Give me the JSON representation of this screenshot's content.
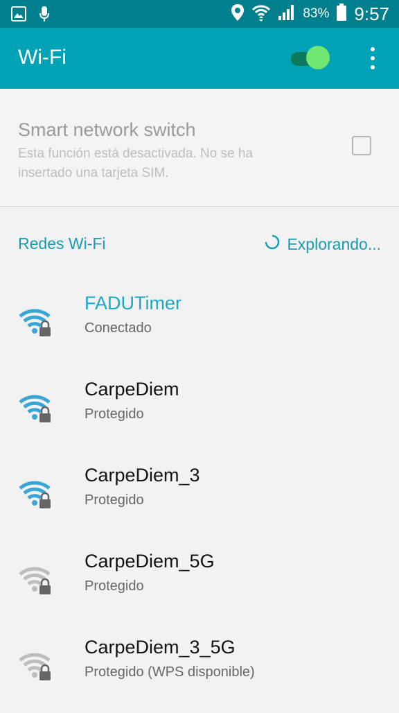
{
  "status_bar": {
    "left_icons": [
      "image-icon",
      "mic-icon"
    ],
    "right_icons": [
      "location-icon",
      "wifi-status-icon",
      "signal-icon",
      "battery-icon"
    ],
    "battery": "83%",
    "time": "9:57"
  },
  "header": {
    "title": "Wi-Fi",
    "wifi_enabled": true
  },
  "smart_switch": {
    "title": "Smart network switch",
    "description": "Esta función está desactivada. No se ha insertado una tarjeta SIM.",
    "checked": false
  },
  "networks_section": {
    "title": "Redes Wi-Fi",
    "scan_status": "Explorando..."
  },
  "networks": [
    {
      "name": "FADUTimer",
      "status": "Conectado",
      "connected": true,
      "icon": "wifi-lock-icon",
      "color": "#39a6d8"
    },
    {
      "name": "CarpeDiem",
      "status": "Protegido",
      "connected": false,
      "icon": "wifi-lock-icon",
      "color": "#39a6d8"
    },
    {
      "name": "CarpeDiem_3",
      "status": "Protegido",
      "connected": false,
      "icon": "wifi-lock-icon",
      "color": "#39a6d8"
    },
    {
      "name": "CarpeDiem_5G",
      "status": "Protegido",
      "connected": false,
      "icon": "wifi-lock-icon",
      "color": "#bdbdbd"
    },
    {
      "name": "CarpeDiem_3_5G",
      "status": "Protegido (WPS disponible)",
      "connected": false,
      "icon": "wifi-lock-icon",
      "color": "#bdbdbd"
    }
  ],
  "colors": {
    "status_bar": "#00808f",
    "app_bar": "#00a3b5",
    "accent": "#1a9bb1",
    "connected_name": "#1ba9c9",
    "toggle_thumb": "#71e672"
  }
}
